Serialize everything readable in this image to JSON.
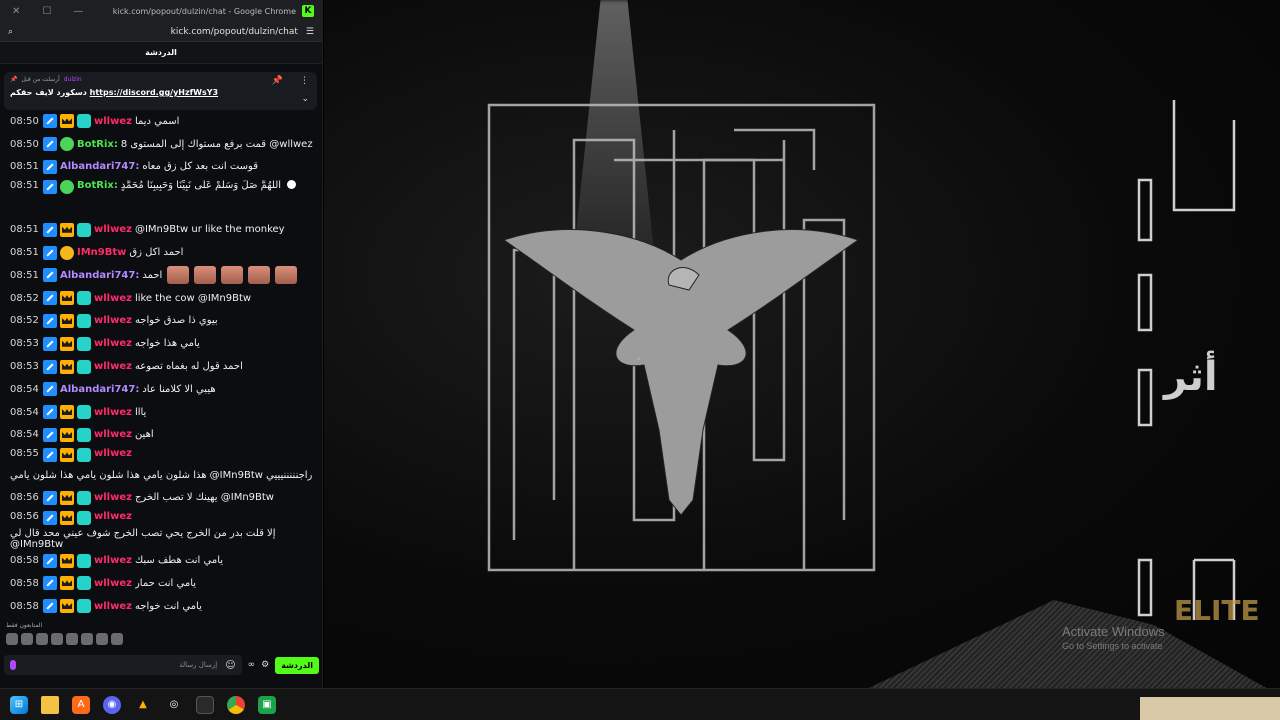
{
  "window": {
    "title": "kick.com/popout/dulzin/chat - Google Chrome",
    "url": "kick.com/popout/dulzin/chat",
    "chat_header": "الدردشة"
  },
  "pinned": {
    "pinned_by_label": "أرسلت من قبل",
    "pinned_by_user": "dulzin",
    "message_prefix": "دسكورد لايف حقكم",
    "link": "https://discord.gg/yHzfWsY3"
  },
  "messages": [
    {
      "time": "08:50",
      "user": "wllwez",
      "text": "اسمي ديما"
    },
    {
      "time": "08:50",
      "user": "BotRix:",
      "text": "قمت برفع مستواك إلى المستوى 8 @wllwez"
    },
    {
      "time": "08:51",
      "user": "Albandari747:",
      "text": "قوست انت بعد كل زق معاه"
    },
    {
      "time": "08:51",
      "user": "BotRix:",
      "text": "اللَّهُمَّ صَلِّ وَسَلِّمْ عَلَى نَبِيِّنَا وَحَبِيبِنَا مُحَمَّدٍ"
    },
    {
      "time": "08:51",
      "user": "wllwez",
      "text": "@IMn9Btw ur like the monkey"
    },
    {
      "time": "08:51",
      "user": "IMn9Btw",
      "text": "احمد اكل زق"
    },
    {
      "time": "08:51",
      "user": "Albandari747:",
      "text": "احمد"
    },
    {
      "time": "08:52",
      "user": "wllwez",
      "text": "like the cow @IMn9Btw"
    },
    {
      "time": "08:52",
      "user": "wllwez",
      "text": "بيوي ذا صدق خواجه"
    },
    {
      "time": "08:53",
      "user": "wllwez",
      "text": "يامي هذا خواجه"
    },
    {
      "time": "08:53",
      "user": "wllwez",
      "text": "احمد قول له بغماه تصوعه"
    },
    {
      "time": "08:54",
      "user": "Albandari747:",
      "text": "هيبي الا كلامنا عاد"
    },
    {
      "time": "08:54",
      "user": "wllwez",
      "text": "يااا"
    },
    {
      "time": "08:54",
      "user": "wllwez",
      "text": "اهين"
    },
    {
      "time": "08:55",
      "user": "wllwez",
      "text": "هذا شلون يامي هذا شلون يامي هذا شلون يامي @IMn9Btw راجنننننيييي"
    },
    {
      "time": "08:56",
      "user": "wllwez",
      "text": "يهينك لا تصب الخرج @IMn9Btw"
    },
    {
      "time": "08:56",
      "user": "wllwez",
      "text": "إلا قلت بدر من الخرج يحي تصب الخرج شوف عيني محد قال لي @IMn9Btw"
    },
    {
      "time": "08:58",
      "user": "wllwez",
      "text": "يامي انت هطف سبك"
    },
    {
      "time": "08:58",
      "user": "wllwez",
      "text": "يامي انت حمار"
    },
    {
      "time": "08:58",
      "user": "wllwez",
      "text": "يامي انت خواجه"
    }
  ],
  "footer": {
    "users_label": "المتابعون فقط",
    "input_placeholder": "إرسال رسالة",
    "send_label": "الدردشة"
  },
  "art": {
    "side_text": "أثر",
    "logo_text": "ELITE"
  },
  "watermark": {
    "line1": "Activate Windows",
    "line2": "Go to Settings to activate"
  },
  "colors": {
    "kick_green": "#53fc18",
    "username_pink": "#ff2b6b",
    "botrix_green": "#4fe34f",
    "albandari_purple": "#b58aff"
  }
}
